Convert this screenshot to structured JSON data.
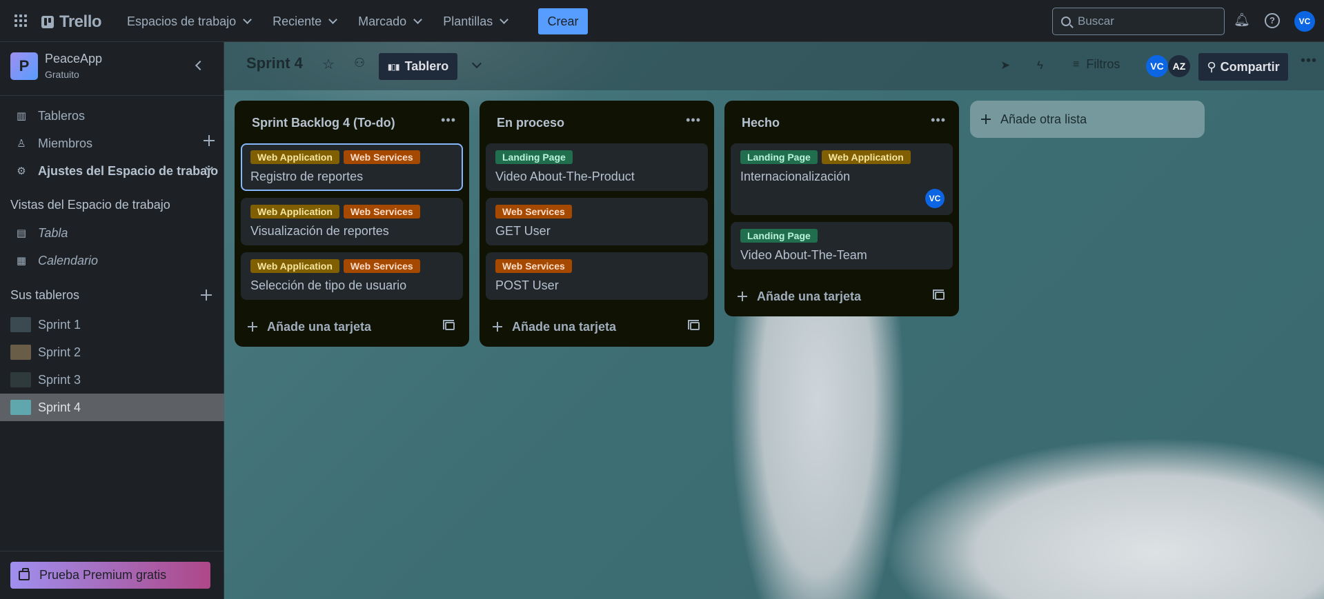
{
  "topbar": {
    "logo": "Trello",
    "nav": [
      {
        "label": "Espacios de trabajo"
      },
      {
        "label": "Reciente"
      },
      {
        "label": "Marcado"
      },
      {
        "label": "Plantillas"
      }
    ],
    "create_label": "Crear",
    "search_placeholder": "Buscar",
    "user_initials": "VC"
  },
  "sidebar": {
    "workspace": {
      "initial": "P",
      "name": "PeaceApp",
      "plan": "Gratuito"
    },
    "items": [
      {
        "label": "Tableros",
        "icon": "board-icon"
      },
      {
        "label": "Miembros",
        "icon": "person-icon"
      },
      {
        "label": "Ajustes del Espacio de trabajo",
        "icon": "gear-icon"
      }
    ],
    "views_title": "Vistas del Espacio de trabajo",
    "views": [
      {
        "label": "Tabla",
        "icon": "table-icon"
      },
      {
        "label": "Calendario",
        "icon": "calendar-icon"
      }
    ],
    "boards_title": "Sus tableros",
    "boards": [
      {
        "label": "Sprint 1",
        "thumb": "#3a4a50"
      },
      {
        "label": "Sprint 2",
        "thumb": "#6a5d48"
      },
      {
        "label": "Sprint 3",
        "thumb": "#2f3a3c"
      },
      {
        "label": "Sprint 4",
        "thumb": "#5fa7ad"
      }
    ],
    "premium_label": "Prueba Premium gratis"
  },
  "board": {
    "title": "Sprint 4",
    "view_label": "Tablero",
    "filters_label": "Filtros",
    "members": [
      {
        "initials": "VC",
        "color": "#0c66e4"
      },
      {
        "initials": "AZ",
        "color": "#1f2a3a"
      }
    ],
    "share_label": "Compartir",
    "add_card_label": "Añade una tarjeta",
    "add_list_label": "Añade otra lista",
    "lists": [
      {
        "title": "Sprint Backlog 4 (To-do)",
        "cards": [
          {
            "labels": [
              {
                "text": "Web Application",
                "color": "yellow"
              },
              {
                "text": "Web Services",
                "color": "orange"
              }
            ],
            "title": "Registro de reportes"
          },
          {
            "labels": [
              {
                "text": "Web Application",
                "color": "yellow"
              },
              {
                "text": "Web Services",
                "color": "orange"
              }
            ],
            "title": "Visualización de reportes"
          },
          {
            "labels": [
              {
                "text": "Web Application",
                "color": "yellow"
              },
              {
                "text": "Web Services",
                "color": "orange"
              }
            ],
            "title": "Selección de tipo de usuario"
          }
        ]
      },
      {
        "title": "En proceso",
        "cards": [
          {
            "labels": [
              {
                "text": "Landing Page",
                "color": "green"
              }
            ],
            "title": "Video About-The-Product"
          },
          {
            "labels": [
              {
                "text": "Web Services",
                "color": "orange"
              }
            ],
            "title": "GET User"
          },
          {
            "labels": [
              {
                "text": "Web Services",
                "color": "orange"
              }
            ],
            "title": "POST User"
          }
        ]
      },
      {
        "title": "Hecho",
        "cards": [
          {
            "labels": [
              {
                "text": "Landing Page",
                "color": "green"
              },
              {
                "text": "Web Application",
                "color": "yellow"
              }
            ],
            "title": "Internacionalización",
            "member": "VC"
          },
          {
            "labels": [
              {
                "text": "Landing Page",
                "color": "green"
              }
            ],
            "title": "Video About-The-Team"
          }
        ]
      }
    ]
  }
}
